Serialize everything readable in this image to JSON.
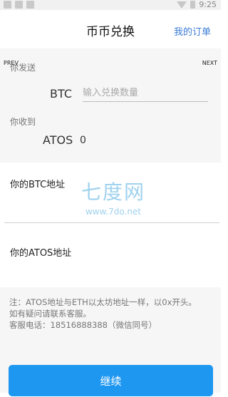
{
  "status_bar": {
    "time": "9:25"
  },
  "header": {
    "title": "币币兑换",
    "orders_link": "我的订单"
  },
  "nav": {
    "prev": "PREV",
    "next": "NEXT"
  },
  "send": {
    "label": "你发送",
    "currency": "BTC",
    "amount_placeholder": "输入兑换数量"
  },
  "receive": {
    "label": "你收到",
    "currency": "ATOS",
    "amount": "0"
  },
  "btc_address": {
    "label": "你的BTC地址"
  },
  "atos_address": {
    "label": "你的ATOS地址"
  },
  "watermark": {
    "brand": "七度网",
    "url": "www.7do.net"
  },
  "notes": {
    "line1": "注：ATOS地址与ETH以太坊地址一样，以0x开头。",
    "line2": "如有疑问请联系客服。",
    "line3": "客服电话：18516888388（微信同号）"
  },
  "continue_button": {
    "label": "继续"
  }
}
